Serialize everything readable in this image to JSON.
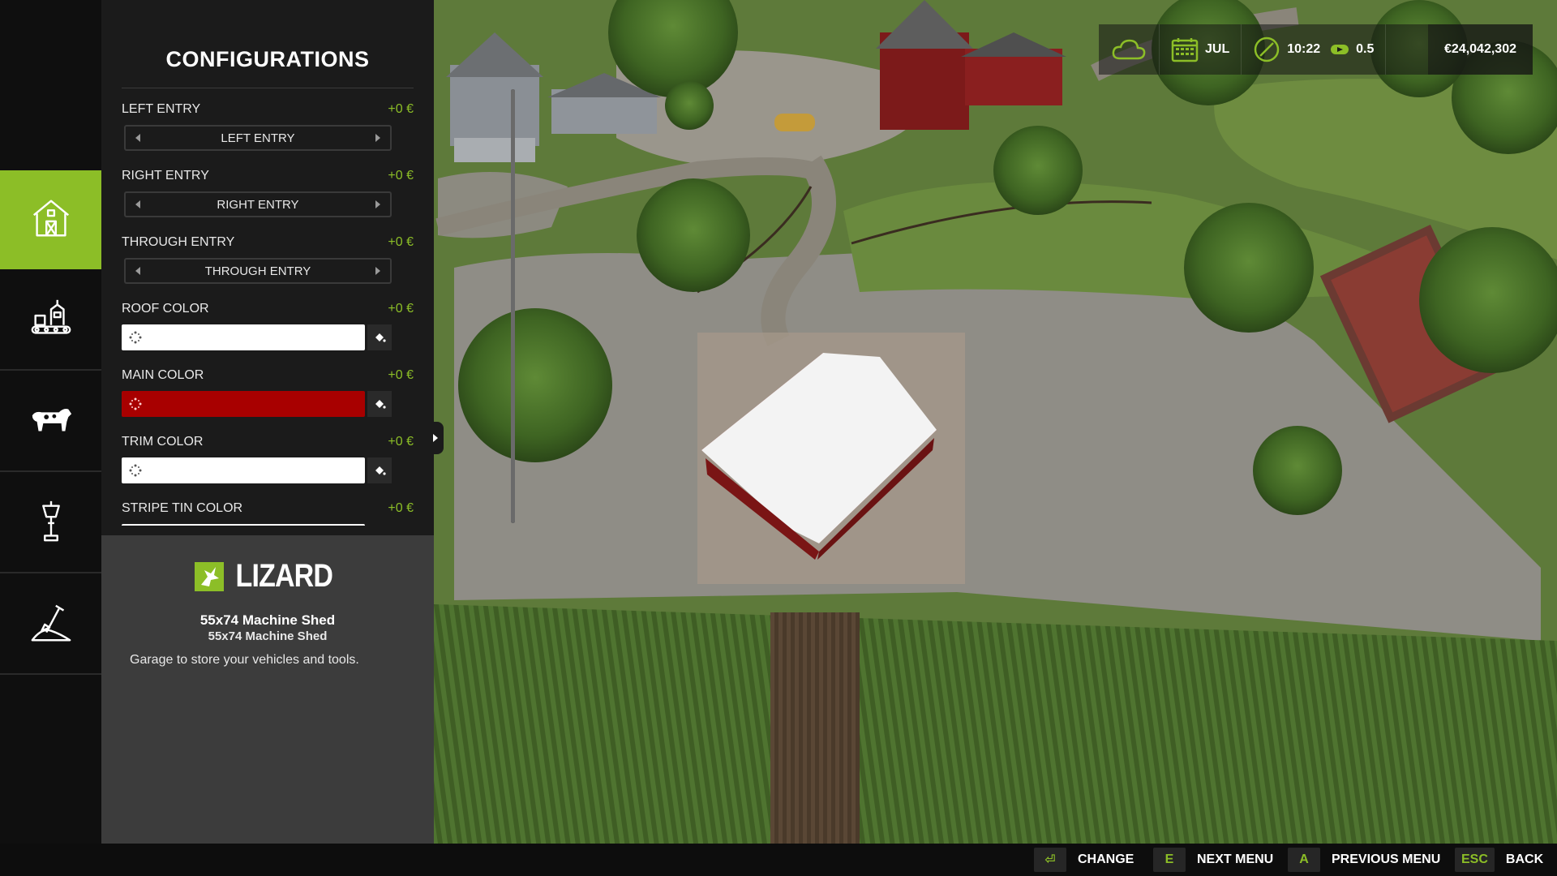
{
  "panel": {
    "title": "CONFIGURATIONS",
    "configs": [
      {
        "label": "LEFT ENTRY",
        "price": "+0 €",
        "kind": "select",
        "value": "LEFT ENTRY"
      },
      {
        "label": "RIGHT ENTRY",
        "price": "+0 €",
        "kind": "select",
        "value": "RIGHT ENTRY"
      },
      {
        "label": "THROUGH ENTRY",
        "price": "+0 €",
        "kind": "select",
        "value": "THROUGH ENTRY"
      },
      {
        "label": "ROOF COLOR",
        "price": "+0 €",
        "kind": "color",
        "color": "#ffffff"
      },
      {
        "label": "MAIN COLOR",
        "price": "+0 €",
        "kind": "color",
        "color": "#a80000"
      },
      {
        "label": "TRIM COLOR",
        "price": "+0 €",
        "kind": "color",
        "color": "#ffffff"
      },
      {
        "label": "STRIPE TIN COLOR",
        "price": "+0 €",
        "kind": "color",
        "color": "#ffffff"
      }
    ]
  },
  "rail": {
    "items": [
      {
        "icon": "barn-icon",
        "active": true
      },
      {
        "icon": "production-icon",
        "active": false
      },
      {
        "icon": "cow-icon",
        "active": false
      },
      {
        "icon": "lamp-icon",
        "active": false
      },
      {
        "icon": "landscaping-icon",
        "active": false
      }
    ]
  },
  "info": {
    "brand": "LIZARD",
    "name": "55x74 Machine Shed",
    "subname": "55x74 Machine Shed",
    "description": "Garage to store your vehicles and tools."
  },
  "hud": {
    "month": "JUL",
    "time": "10:22",
    "speed": "0.5",
    "money": "€24,042,302"
  },
  "hints": [
    {
      "key": "⏎",
      "label": "CHANGE"
    },
    {
      "key": "E",
      "label": "NEXT MENU"
    },
    {
      "key": "A",
      "label": "PREVIOUS MENU"
    },
    {
      "key": "ESC",
      "label": "BACK"
    }
  ],
  "colors": {
    "accent": "#8cbe27",
    "panel": "#1b1b1b",
    "info_panel": "#3c3c3c"
  }
}
